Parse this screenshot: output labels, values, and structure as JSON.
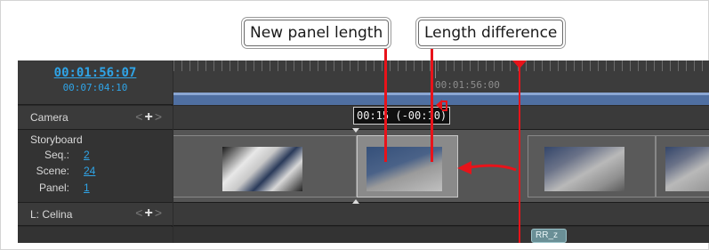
{
  "callouts": {
    "new_panel_length": "New panel length",
    "length_difference": "Length difference"
  },
  "timecode": {
    "current": "00:01:56:07",
    "total": "00:07:04:10"
  },
  "ruler": {
    "marker_time": "00:01:56:00"
  },
  "tracks": {
    "camera_label": "Camera",
    "storyboard_label": "Storyboard",
    "layer_label": "L: Celina",
    "ctrl_prev": "<",
    "ctrl_add": "+",
    "ctrl_next": ">"
  },
  "storyboard": {
    "seq_label": "Seq.:",
    "seq_value": "2",
    "scene_label": "Scene:",
    "scene_value": "24",
    "panel_label": "Panel:",
    "panel_value": "1"
  },
  "panel_length_readout": "00:15 (-00:10)",
  "clip_marker": "RR_z",
  "colors": {
    "accent_link": "#2fa4e7",
    "playhead": "#e8131a",
    "callout_line": "#e8131a"
  }
}
